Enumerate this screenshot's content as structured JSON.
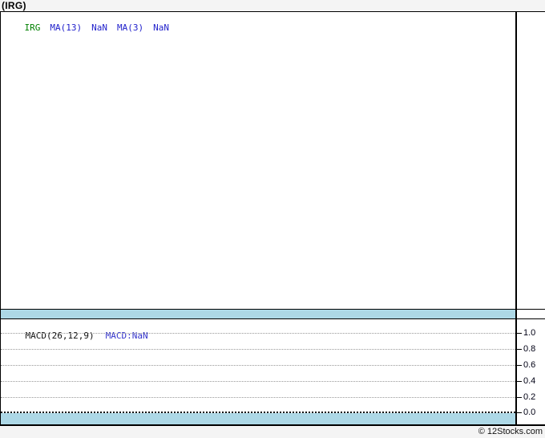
{
  "header": {
    "title": "(IRG)"
  },
  "footer": {
    "credit": "© 12Stocks.com"
  },
  "colors": {
    "page_bg": "#f4f4f4",
    "panel_bg": "#ffffff",
    "axis_band": "#add8e6",
    "border": "#000000",
    "grid_dotted": "#999999",
    "zero_line": "#111111",
    "legend_symbol_green": "#008000",
    "legend_blue": "#2222cc",
    "macd_value_blue": "#3333cc"
  },
  "price_panel": {
    "legend": [
      {
        "label": "IRG",
        "color": "#008000"
      },
      {
        "label": "MA(13)",
        "color": "#2222cc"
      },
      {
        "label": "NaN",
        "color": "#2222cc"
      },
      {
        "label": "MA(3)",
        "color": "#2222cc"
      },
      {
        "label": "NaN",
        "color": "#2222cc"
      }
    ]
  },
  "macd_panel": {
    "label": "MACD(26,12,9)",
    "value": "MACD:NaN",
    "yticks": [
      {
        "label": "1.0"
      },
      {
        "label": "0.8"
      },
      {
        "label": "0.6"
      },
      {
        "label": "0.4"
      },
      {
        "label": "0.2"
      },
      {
        "label": "0.0"
      }
    ]
  },
  "chart_data": [
    {
      "type": "line",
      "title": "IRG price panel",
      "series": [
        {
          "name": "IRG",
          "values": []
        },
        {
          "name": "MA(13)",
          "values": [],
          "current": "NaN"
        },
        {
          "name": "MA(3)",
          "values": [],
          "current": "NaN"
        }
      ],
      "legend_position": "top-left",
      "grid": false,
      "note": "Panel is empty — no price data plotted (all values NaN)"
    },
    {
      "type": "line",
      "title": "MACD(26,12,9)",
      "series": [
        {
          "name": "MACD",
          "values": [],
          "current": "NaN"
        }
      ],
      "ylim": [
        0.0,
        1.0
      ],
      "yticks": [
        1.0,
        0.8,
        0.6,
        0.4,
        0.2,
        0.0
      ],
      "grid": true,
      "legend_position": "top-left",
      "note": "Panel is empty — MACD value is NaN"
    }
  ]
}
